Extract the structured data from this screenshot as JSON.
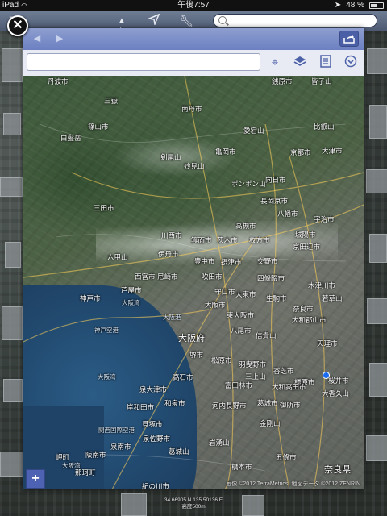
{
  "status_bar": {
    "carrier": "iPad",
    "time": "午後7:57",
    "battery": "48 %"
  },
  "toolbar": {
    "compass_label": "N",
    "search_placeholder": ""
  },
  "panel": {
    "search_value": ""
  },
  "map": {
    "labels": [
      [
        "丹波市",
        30,
        1,
        false
      ],
      [
        "銭原市",
        308,
        1,
        false
      ],
      [
        "皆子山",
        357,
        1,
        false
      ],
      [
        "三嶽",
        100,
        25,
        false
      ],
      [
        "南丹市",
        196,
        35,
        false
      ],
      [
        "比叡山",
        360,
        57,
        false
      ],
      [
        "篠山市",
        80,
        57,
        false
      ],
      [
        "愛宕山",
        273,
        62,
        false
      ],
      [
        "白髪岳",
        46,
        71,
        false
      ],
      [
        "京都市",
        331,
        89,
        false
      ],
      [
        "大津市",
        370,
        87,
        false
      ],
      [
        "亀岡市",
        238,
        88,
        false
      ],
      [
        "剣尾山",
        170,
        95,
        false
      ],
      [
        "妙見山",
        199,
        106,
        false
      ],
      [
        "ポンポン山",
        258,
        128,
        false
      ],
      [
        "向日市",
        300,
        123,
        false
      ],
      [
        "長岡京市",
        294,
        149,
        false
      ],
      [
        "三田市",
        87,
        158,
        false
      ],
      [
        "八幡市",
        315,
        165,
        false
      ],
      [
        "宇治市",
        360,
        172,
        false
      ],
      [
        "高槻市",
        263,
        180,
        false
      ],
      [
        "城陽市",
        337,
        191,
        false
      ],
      [
        "川西市",
        171,
        192,
        false
      ],
      [
        "箕面市",
        208,
        198,
        false
      ],
      [
        "茨木市",
        240,
        198,
        false
      ],
      [
        "枚方市",
        280,
        198,
        false
      ],
      [
        "京田辺市",
        334,
        206,
        false
      ],
      [
        "伊丹市",
        167,
        215,
        false
      ],
      [
        "六甲山",
        104,
        219,
        false
      ],
      [
        "豊中市",
        212,
        224,
        false
      ],
      [
        "摂津市",
        245,
        225,
        false
      ],
      [
        "交野市",
        290,
        224,
        false
      ],
      [
        "西宮市",
        138,
        243,
        false
      ],
      [
        "尼崎市",
        166,
        243,
        false
      ],
      [
        "吹田市",
        221,
        243,
        false
      ],
      [
        "四條畷市",
        290,
        245,
        false
      ],
      [
        "木津川市",
        353,
        254,
        false
      ],
      [
        "守口市",
        237,
        262,
        false
      ],
      [
        "大東市",
        263,
        265,
        false
      ],
      [
        "芦屋市",
        121,
        260,
        false
      ],
      [
        "生駒市",
        301,
        270,
        false
      ],
      [
        "若草山",
        370,
        270,
        false
      ],
      [
        "神戸市",
        70,
        270,
        false
      ],
      [
        "大阪市",
        225,
        278,
        false
      ],
      [
        "奈良市",
        334,
        283,
        false
      ],
      [
        "東大阪市",
        252,
        291,
        false
      ],
      [
        "大和郡山市",
        333,
        297,
        false
      ],
      [
        "八尾市",
        257,
        310,
        false
      ],
      [
        "信貴山",
        288,
        316,
        false
      ],
      [
        "天理市",
        364,
        326,
        false
      ],
      [
        "大阪府",
        192,
        317,
        true
      ],
      [
        "堺市",
        206,
        340,
        false
      ],
      [
        "松原市",
        233,
        347,
        false
      ],
      [
        "羽曳野市",
        267,
        352,
        false
      ],
      [
        "香芝市",
        310,
        360,
        false
      ],
      [
        "高石市",
        185,
        368,
        false
      ],
      [
        "三上山",
        275,
        367,
        false
      ],
      [
        "富田林市",
        250,
        378,
        false
      ],
      [
        "橿原市",
        336,
        374,
        false
      ],
      [
        "桜井市",
        378,
        372,
        false
      ],
      [
        "泉大津市",
        144,
        383,
        false
      ],
      [
        "大和高田市",
        308,
        380,
        false
      ],
      [
        "大香久山",
        370,
        388,
        false
      ],
      [
        "岸和田市",
        128,
        405,
        false
      ],
      [
        "和泉市",
        175,
        400,
        false
      ],
      [
        "河内長野市",
        234,
        403,
        false
      ],
      [
        "葛城市",
        290,
        400,
        false
      ],
      [
        "御所市",
        318,
        402,
        false
      ],
      [
        "金剛山",
        293,
        425,
        false
      ],
      [
        "貝塚市",
        147,
        426,
        false
      ],
      [
        "泉佐野市",
        148,
        444,
        false
      ],
      [
        "岩湧山",
        230,
        449,
        false
      ],
      [
        "五條市",
        313,
        467,
        false
      ],
      [
        "阪南市",
        77,
        464,
        false
      ],
      [
        "泉南市",
        108,
        454,
        false
      ],
      [
        "葛城山",
        180,
        460,
        false
      ],
      [
        "橋本市",
        258,
        479,
        false
      ],
      [
        "岬町",
        40,
        467,
        false
      ],
      [
        "奈良県",
        373,
        480,
        true
      ],
      [
        "紀の川市",
        147,
        503,
        false
      ],
      [
        "那珂町",
        64,
        486,
        false
      ]
    ],
    "water_labels": [
      [
        "大阪湾",
        122,
        276
      ],
      [
        "大阪港",
        173,
        294
      ],
      [
        "神戸空港",
        88,
        310
      ],
      [
        "大阪湾",
        92,
        368
      ],
      [
        "関西国際空港",
        93,
        434
      ],
      [
        "大阪湾",
        48,
        478
      ]
    ],
    "copyright": "画像 ©2012 TerraMetrics, 地図データ ©2012 ZENRIN"
  },
  "coords": {
    "line1": "34.66905 N 135.50136 E",
    "line2": "高度500m"
  }
}
